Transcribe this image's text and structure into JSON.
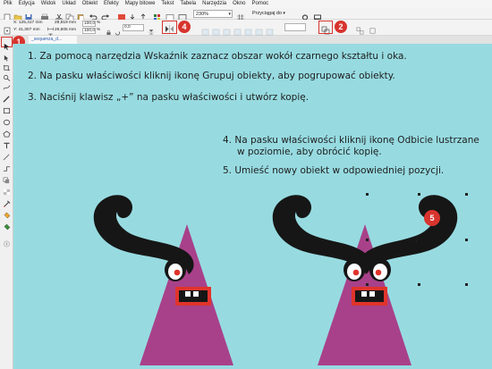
{
  "menu": {
    "items": [
      "Plik",
      "Edycja",
      "Widok",
      "Układ",
      "Obiekt",
      "Efekty",
      "Mapy bitowe",
      "Tekst",
      "Tabela",
      "Narzędzia",
      "Okno",
      "Pomoc"
    ]
  },
  "toolbar": {
    "zoom": "230%",
    "snap_label": "Przyciągaj do"
  },
  "properties": {
    "x": "X: 125,417 mm",
    "y": "Y: 41,307 mm",
    "width": "28,819 mm",
    "height": "26,605 mm",
    "scale_x": "100,0",
    "scale_y": "100,0",
    "pct": "%",
    "angle": "0,0"
  },
  "document": {
    "tab_label": "_sequenza_d..."
  },
  "instructions": {
    "step1": "1.  Za pomocą narzędzia Wskaźnik zaznacz obszar wokół czarnego kształtu i oka.",
    "step2": "2.  Na pasku właściwości kliknij ikonę Grupuj obiekty, aby pogrupować obiekty.",
    "step3": "3.  Naciśnij klawisz „+” na pasku właściwości i utwórz kopię.",
    "step4_line1": "4.  Na pasku właściwości kliknij ikonę Odbicie lustrzane",
    "step4_line2": "w poziomie, aby obrócić kopię.",
    "step5": "5.  Umieść nowy obiekt w odpowiedniej pozycji."
  },
  "badges": [
    "1",
    "2",
    "4",
    "5"
  ],
  "colors": {
    "highlight": "#d8342e",
    "canvas": "#97dbe1",
    "triangle": "#a8418a",
    "mouth": "#e0342b"
  },
  "icons": {
    "group": "group-objects-icon",
    "mirror": "mirror-horizontal-icon",
    "pick": "pick-tool-icon"
  }
}
